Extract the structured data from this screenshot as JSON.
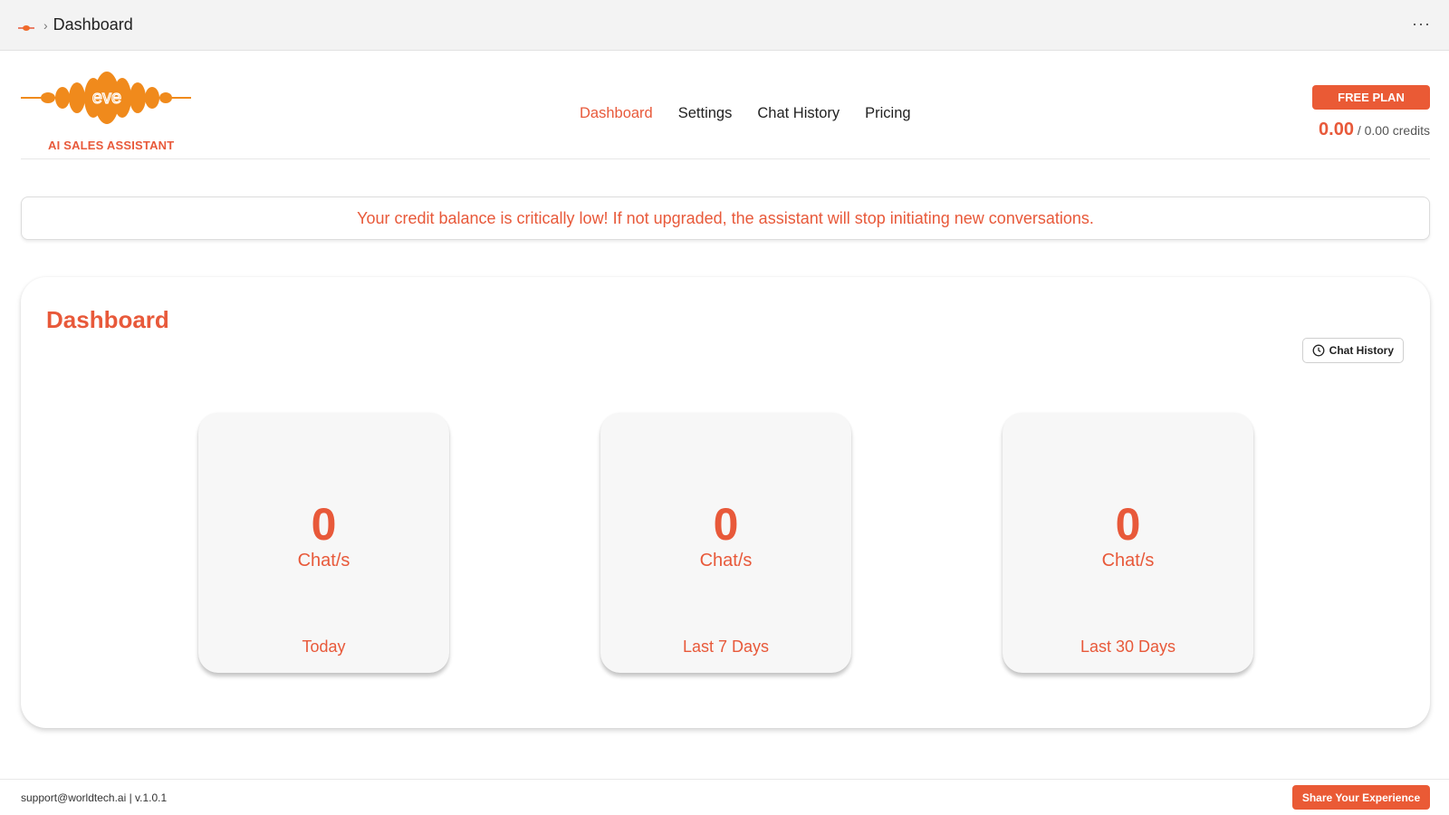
{
  "topbar": {
    "breadcrumb": "Dashboard",
    "separator": "›",
    "more": "···"
  },
  "header": {
    "logo_text": "eve",
    "logo_tagline": "AI SALES ASSISTANT",
    "nav": [
      {
        "label": "Dashboard",
        "active": true
      },
      {
        "label": "Settings",
        "active": false
      },
      {
        "label": "Chat History",
        "active": false
      },
      {
        "label": "Pricing",
        "active": false
      }
    ],
    "plan_label": "FREE PLAN",
    "credits_used": "0.00",
    "credits_total": "/ 0.00 credits"
  },
  "alert": {
    "message": "Your credit balance is critically low! If not upgraded, the assistant will stop initiating new conversations."
  },
  "dashboard": {
    "title": "Dashboard",
    "history_button": "Chat History",
    "history_icon": "clock-icon",
    "stats": [
      {
        "value": "0",
        "unit": "Chat/s",
        "period": "Today"
      },
      {
        "value": "0",
        "unit": "Chat/s",
        "period": "Last 7 Days"
      },
      {
        "value": "0",
        "unit": "Chat/s",
        "period": "Last 30 Days"
      }
    ]
  },
  "footer": {
    "support": "support@worldtech.ai | v.1.0.1",
    "share_button": "Share Your Experience"
  },
  "colors": {
    "accent": "#e8593a",
    "button": "#ea5a35",
    "logo_orange": "#f08a1c"
  }
}
